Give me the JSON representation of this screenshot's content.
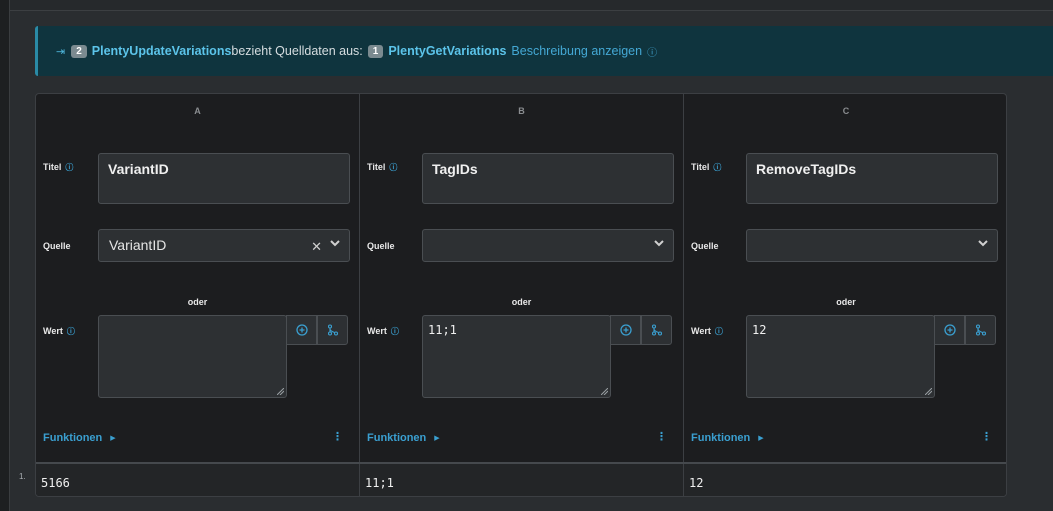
{
  "banner": {
    "step_badge": "2",
    "step_name": "PlentyUpdateVariations",
    "text": "bezieht Quelldaten aus:",
    "source_badge": "1",
    "source_name": "PlentyGetVariations",
    "link": "Beschreibung anzeigen"
  },
  "labels": {
    "titel": "Titel",
    "quelle": "Quelle",
    "oder": "oder",
    "wert": "Wert",
    "funktionen": "Funktionen"
  },
  "columns": [
    {
      "header": "A",
      "title": "VariantID",
      "source": "VariantID",
      "value": "",
      "result": "5166"
    },
    {
      "header": "B",
      "title": "TagIDs",
      "source": "",
      "value": "11;1",
      "result": "11;1"
    },
    {
      "header": "C",
      "title": "RemoveTagIDs",
      "source": "",
      "value": "12",
      "result": "12"
    }
  ],
  "row_number": "1.",
  "colors": {
    "accent": "#3a9fd0",
    "banner_bg": "#0f343e",
    "panel_bg": "#1c1d1f",
    "input_bg": "#2d3033"
  }
}
